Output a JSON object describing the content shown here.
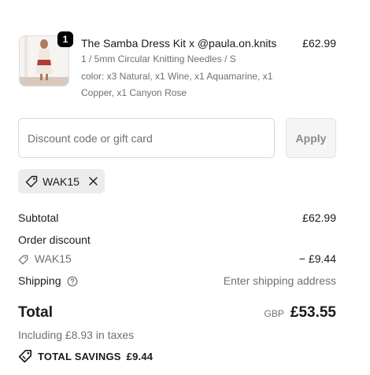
{
  "product": {
    "quantity": "1",
    "name": "The Samba Dress Kit x @paula.on.knits",
    "price": "£62.99",
    "variant": "1 / 5mm Circular Knitting Needles / S",
    "color": "color: x3 Natural, x1 Wine, x1 Aquamarine, x1 Copper, x1 Canyon Rose",
    "thumbnail_icon": "product-photo"
  },
  "discount": {
    "placeholder": "Discount code or gift card",
    "value": "",
    "apply_label": "Apply",
    "applied_code": "WAK15"
  },
  "summary": {
    "subtotal_label": "Subtotal",
    "subtotal_value": "£62.99",
    "order_discount_label": "Order discount",
    "discount_code": "WAK15",
    "discount_value": "− £9.44",
    "shipping_label": "Shipping",
    "shipping_value": "Enter shipping address",
    "total_label": "Total",
    "currency": "GBP",
    "total_value": "£53.55",
    "taxes": "Including £8.93 in taxes",
    "savings_label": "TOTAL SAVINGS",
    "savings_value": "£9.44"
  },
  "colors": {
    "text": "#1a1a1a",
    "muted": "#707070",
    "chip_bg": "#ececec",
    "badge_bg": "#000000",
    "button_bg": "#f5f5f5"
  }
}
